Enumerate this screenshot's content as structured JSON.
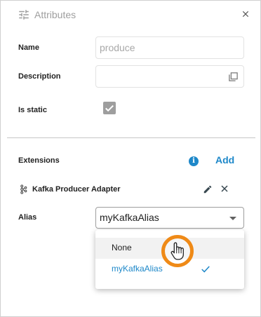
{
  "header": {
    "title": "Attributes",
    "header_icon": "tune-icon",
    "close_icon": "close-icon"
  },
  "form": {
    "name_label": "Name",
    "name_value": "produce",
    "description_label": "Description",
    "description_value": "",
    "is_static_label": "Is static",
    "is_static_checked": true
  },
  "extensions": {
    "label": "Extensions",
    "info_glyph": "i",
    "add_label": "Add",
    "items": [
      {
        "icon": "kafka-icon",
        "name": "Kafka Producer Adapter"
      }
    ]
  },
  "alias": {
    "label": "Alias",
    "selected": "myKafkaAlias",
    "options": [
      {
        "label": "None",
        "highlighted": true,
        "selected": false
      },
      {
        "label": "myKafkaAlias",
        "highlighted": false,
        "selected": true
      }
    ]
  },
  "colors": {
    "accent": "#1e88c9",
    "cursor_ring": "#ef8a17",
    "muted": "#9e9e9e"
  }
}
